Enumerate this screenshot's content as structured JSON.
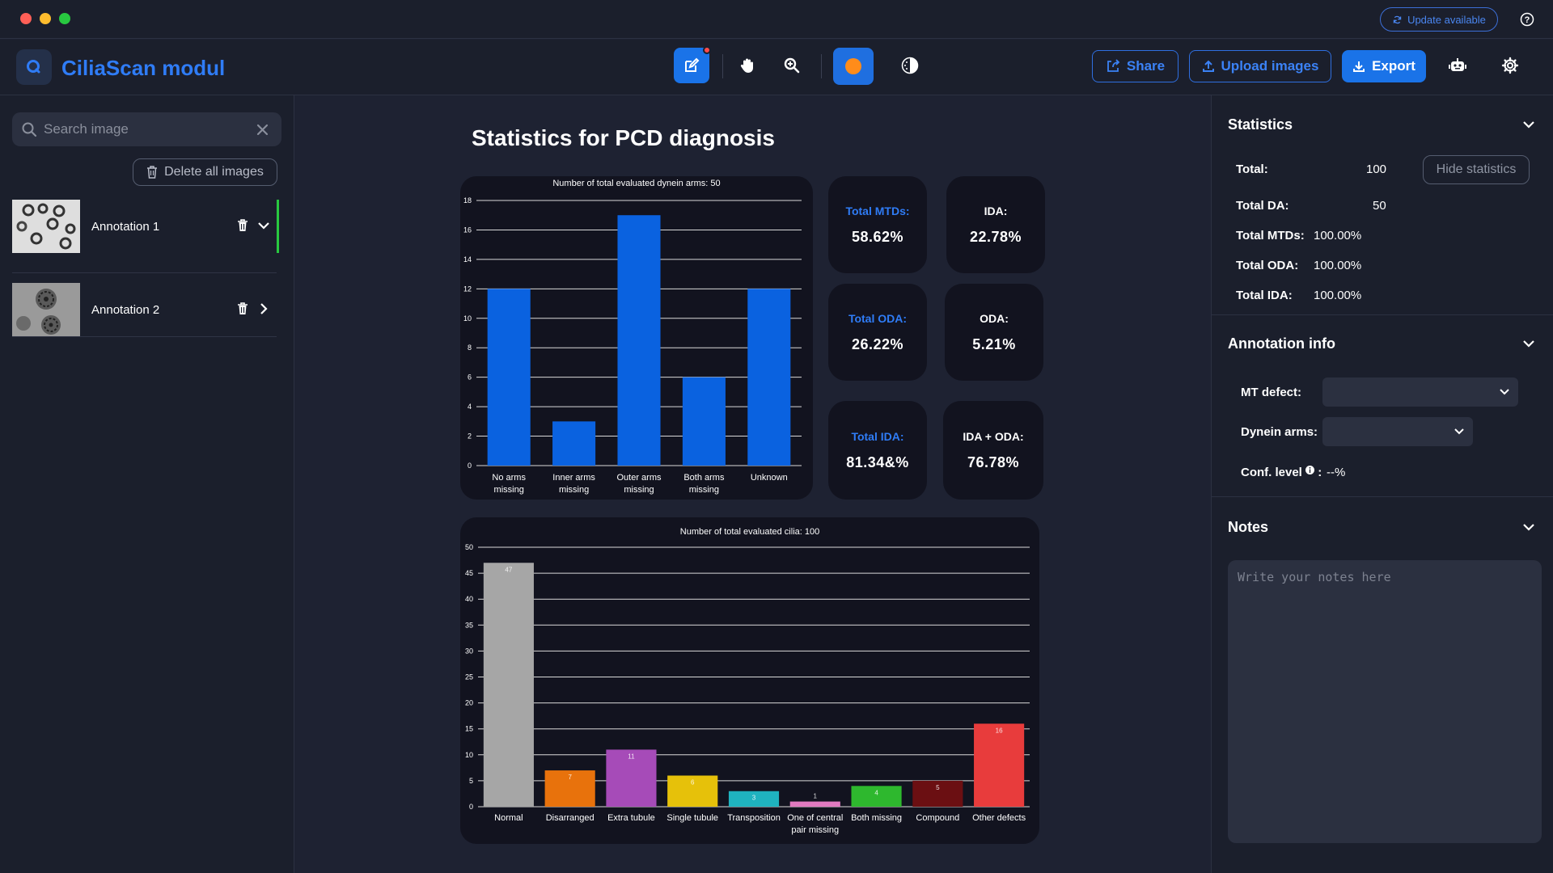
{
  "titlebar": {
    "update_label": "Update available",
    "help_icon": "question-circle-icon"
  },
  "toolbar": {
    "app_name": "CiliaScan modul",
    "logo_icon": "search-icon",
    "tools": [
      "edit-icon",
      "hand-icon",
      "zoom-in-icon",
      "color-circle-icon",
      "contrast-icon"
    ],
    "share_label": "Share",
    "upload_label": "Upload images",
    "export_label": "Export",
    "robot_icon": "robot-icon",
    "settings_icon": "gear-icon",
    "accent": "#1a73e8",
    "active_color": "#ff8c1a"
  },
  "sidebar": {
    "search_placeholder": "Search image",
    "delete_all_label": "Delete all images",
    "annotations": [
      {
        "label": "Annotation 1",
        "expanded": true,
        "active": true
      },
      {
        "label": "Annotation 2",
        "expanded": false,
        "active": false
      }
    ]
  },
  "main": {
    "title": "Statistics for PCD diagnosis",
    "cards": [
      {
        "label": "Total MTDs:",
        "value": "58.62%"
      },
      {
        "label": "IDA:",
        "value": "22.78%"
      },
      {
        "label": "Total ODA:",
        "value": "26.22%"
      },
      {
        "label": "ODA:",
        "value": "5.21%"
      },
      {
        "label": "Total IDA:",
        "value": "81.34&%"
      },
      {
        "label": "IDA + ODA:",
        "value": "76.78%"
      }
    ]
  },
  "chart_data": [
    {
      "type": "bar",
      "title": "Number of total evaluated dynein arms: 50",
      "categories": [
        [
          "No arms",
          "missing"
        ],
        [
          "Inner arms",
          "missing"
        ],
        [
          "Outer arms",
          "missing"
        ],
        [
          "Both arms",
          "missing"
        ],
        [
          "Unknown"
        ]
      ],
      "values": [
        12,
        3,
        17,
        6,
        12
      ],
      "ylim": [
        0,
        18
      ],
      "yticks": [
        0,
        2,
        4,
        6,
        8,
        10,
        12,
        14,
        16,
        18
      ],
      "grid": true,
      "color": "#0a62e0"
    },
    {
      "type": "bar",
      "title": "Number of total evaluated cilia: 100",
      "categories": [
        [
          "Normal"
        ],
        [
          "Disarranged"
        ],
        [
          "Extra tubule"
        ],
        [
          "Single tubule"
        ],
        [
          "Transposition"
        ],
        [
          "One of central",
          "pair missing"
        ],
        [
          "Both missing"
        ],
        [
          "Compound"
        ],
        [
          "Other  defects"
        ]
      ],
      "values": [
        47,
        7,
        11,
        6,
        3,
        1,
        4,
        5,
        16
      ],
      "colors": [
        "#a6a6a6",
        "#e8720c",
        "#a64bb8",
        "#e6c10a",
        "#1fb3bf",
        "#e07ac0",
        "#2eb82e",
        "#6b0f12",
        "#e83c3c"
      ],
      "ylim": [
        0,
        50
      ],
      "yticks": [
        0,
        5,
        10,
        15,
        20,
        25,
        30,
        35,
        40,
        45,
        50
      ],
      "grid": true,
      "data_labels": true
    }
  ],
  "right": {
    "statistics_title": "Statistics",
    "hide_label": "Hide statistics",
    "stats": [
      {
        "label": "Total:",
        "value": "100"
      },
      {
        "label": "Total DA:",
        "value": "50"
      },
      {
        "label": "Total MTDs:",
        "value": "100.00%"
      },
      {
        "label": "Total ODA:",
        "value": "100.00%"
      },
      {
        "label": "Total IDA:",
        "value": "100.00%"
      }
    ],
    "annotation_title": "Annotation info",
    "mt_defect_label": "MT defect:",
    "dynein_label": "Dynein arms:",
    "conf_label": "Conf. level",
    "conf_value": "--%",
    "notes_title": "Notes",
    "notes_placeholder": "Write your notes here"
  }
}
